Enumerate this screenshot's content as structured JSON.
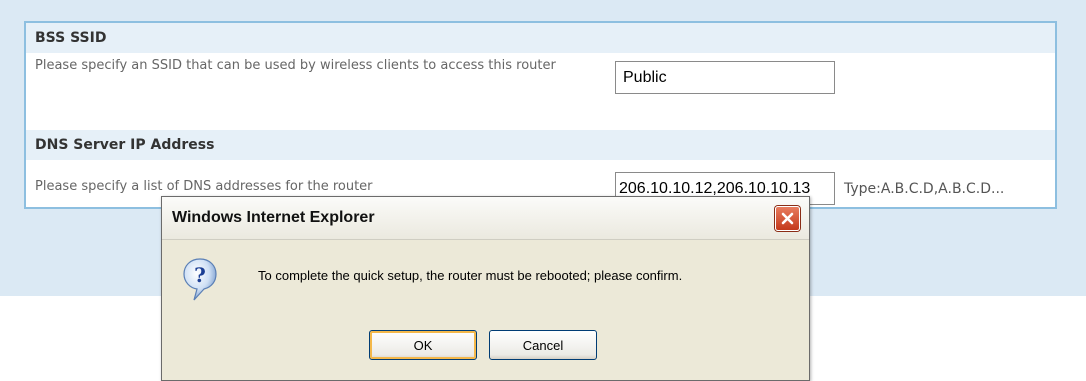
{
  "form": {
    "ssid_section": {
      "title": "BSS SSID",
      "label": "Please specify an SSID that can be used by wireless clients to access this router",
      "value": "Public"
    },
    "dns_section": {
      "title": "DNS Server IP Address",
      "label": "Please specify a list of DNS addresses for the router",
      "value": "206.10.10.12,206.10.10.13",
      "hint": "Type:A.B.C.D,A.B.C.D..."
    }
  },
  "dialog": {
    "title": "Windows Internet Explorer",
    "icon": "question-icon",
    "message": "To complete the quick setup, the router must be rebooted; please confirm.",
    "ok_label": "OK",
    "cancel_label": "Cancel"
  },
  "colors": {
    "panel_border": "#8dbfe0",
    "header_bg": "#e6f0f8",
    "page_bg": "#dbe9f4",
    "close_red": "#c4391b"
  }
}
